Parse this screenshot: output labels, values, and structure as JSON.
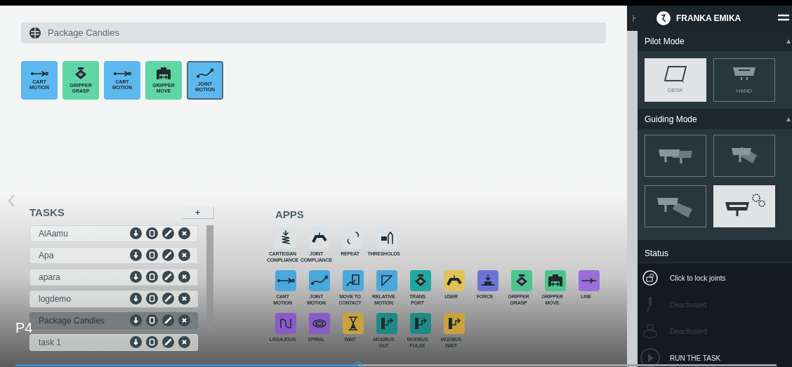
{
  "task_bar": {
    "title": "Package Candies"
  },
  "timeline": [
    {
      "label": "CART\nMOTION",
      "kind": "cart",
      "color": "#5cb8ee",
      "selected": false
    },
    {
      "label": "GRIPPER\nGRASP",
      "kind": "grasp",
      "color": "#5fd6a4",
      "selected": false
    },
    {
      "label": "CART\nMOTION",
      "kind": "cart",
      "color": "#5cb8ee",
      "selected": false
    },
    {
      "label": "GRIPPER\nMOVE",
      "kind": "move",
      "color": "#5fd6a4",
      "selected": false
    },
    {
      "label": "JOINT\nMOTION",
      "kind": "joint",
      "color": "#5cb8ee",
      "selected": true
    }
  ],
  "tasks": {
    "title": "TASKS",
    "add": "+",
    "items": [
      {
        "name": "AlAamu",
        "selected": false
      },
      {
        "name": "Apa",
        "selected": false
      },
      {
        "name": "apara",
        "selected": false
      },
      {
        "name": "logdemo",
        "selected": false
      },
      {
        "name": "Package Candies",
        "selected": true
      },
      {
        "name": "task 1",
        "selected": false
      }
    ]
  },
  "apps": {
    "title": "APPS",
    "rows": [
      [
        {
          "label": "CARTESIAN\nCOMPLIANCE",
          "kind": "spring",
          "color": "#dde1e4"
        },
        {
          "label": "JOINT\nCOMPLIANCE",
          "kind": "arm",
          "color": "#dde1e4"
        },
        {
          "label": "REPEAT",
          "kind": "repeat",
          "color": "#dde1e4"
        },
        {
          "label": "THRESHOLDS",
          "kind": "threshold",
          "color": "#dde1e4"
        }
      ],
      [
        {
          "label": "CART\nMOTION",
          "kind": "cart",
          "color": "#4aa8dc"
        },
        {
          "label": "JOINT\nMOTION",
          "kind": "joint",
          "color": "#4aa8dc"
        },
        {
          "label": "MOVE TO\nCONTACT",
          "kind": "contact",
          "color": "#4aa8dc"
        },
        {
          "label": "RELATIVE\nMOTION",
          "kind": "relative",
          "color": "#4aa8dc"
        },
        {
          "label": "TRANS\nPORT",
          "kind": "grasp",
          "color": "#1fa7a0"
        },
        {
          "label": "USER",
          "kind": "arm",
          "color": "#e0c25a"
        },
        {
          "label": "FORCE",
          "kind": "force",
          "color": "#6b73d6"
        },
        {
          "label": "GRIPPER\nGRASP",
          "kind": "grasp",
          "color": "#4cc48e"
        },
        {
          "label": "GRIPPER\nMOVE",
          "kind": "move",
          "color": "#4cc48e"
        },
        {
          "label": "LINE",
          "kind": "line",
          "color": "#9a6ed8"
        }
      ],
      [
        {
          "label": "LISSAJOUS",
          "kind": "lissajous",
          "color": "#8a5cc8"
        },
        {
          "label": "SPIRAL",
          "kind": "spiral",
          "color": "#8a5cc8"
        },
        {
          "label": "WAIT",
          "kind": "wait",
          "color": "#c9a23e"
        },
        {
          "label": "MODBUS\nOUT",
          "kind": "modbus",
          "color": "#1e8a86"
        },
        {
          "label": "MODBUS\nPULSE",
          "kind": "modbus",
          "color": "#1e8a86"
        },
        {
          "label": "MODBUS\nWAIT",
          "kind": "modbus",
          "color": "#c9a23e"
        }
      ]
    ]
  },
  "sidebar": {
    "brand": "FRANKA EMIKA",
    "pilot_mode": {
      "title": "Pilot Mode",
      "options": [
        {
          "label": "DESK",
          "kind": "desk",
          "selected": true
        },
        {
          "label": "HAND",
          "kind": "hand",
          "selected": false
        }
      ]
    },
    "guiding_mode": {
      "title": "Guiding Mode",
      "options": [
        {
          "kind": "translate",
          "selected": false
        },
        {
          "kind": "rotate",
          "selected": false
        },
        {
          "kind": "both",
          "selected": false
        },
        {
          "kind": "custom",
          "selected": true
        }
      ]
    },
    "status": {
      "title": "Status",
      "items": [
        {
          "label": "Click to lock joints",
          "kind": "lock",
          "disabled": false
        },
        {
          "label": "Deactivated",
          "kind": "pen",
          "disabled": true
        },
        {
          "label": "Deactivated",
          "kind": "box",
          "disabled": true
        },
        {
          "label": "RUN THE TASK",
          "kind": "run",
          "disabled": false
        }
      ]
    }
  },
  "video": {
    "caption": "P4",
    "progress": {
      "level": 0.45
    }
  }
}
